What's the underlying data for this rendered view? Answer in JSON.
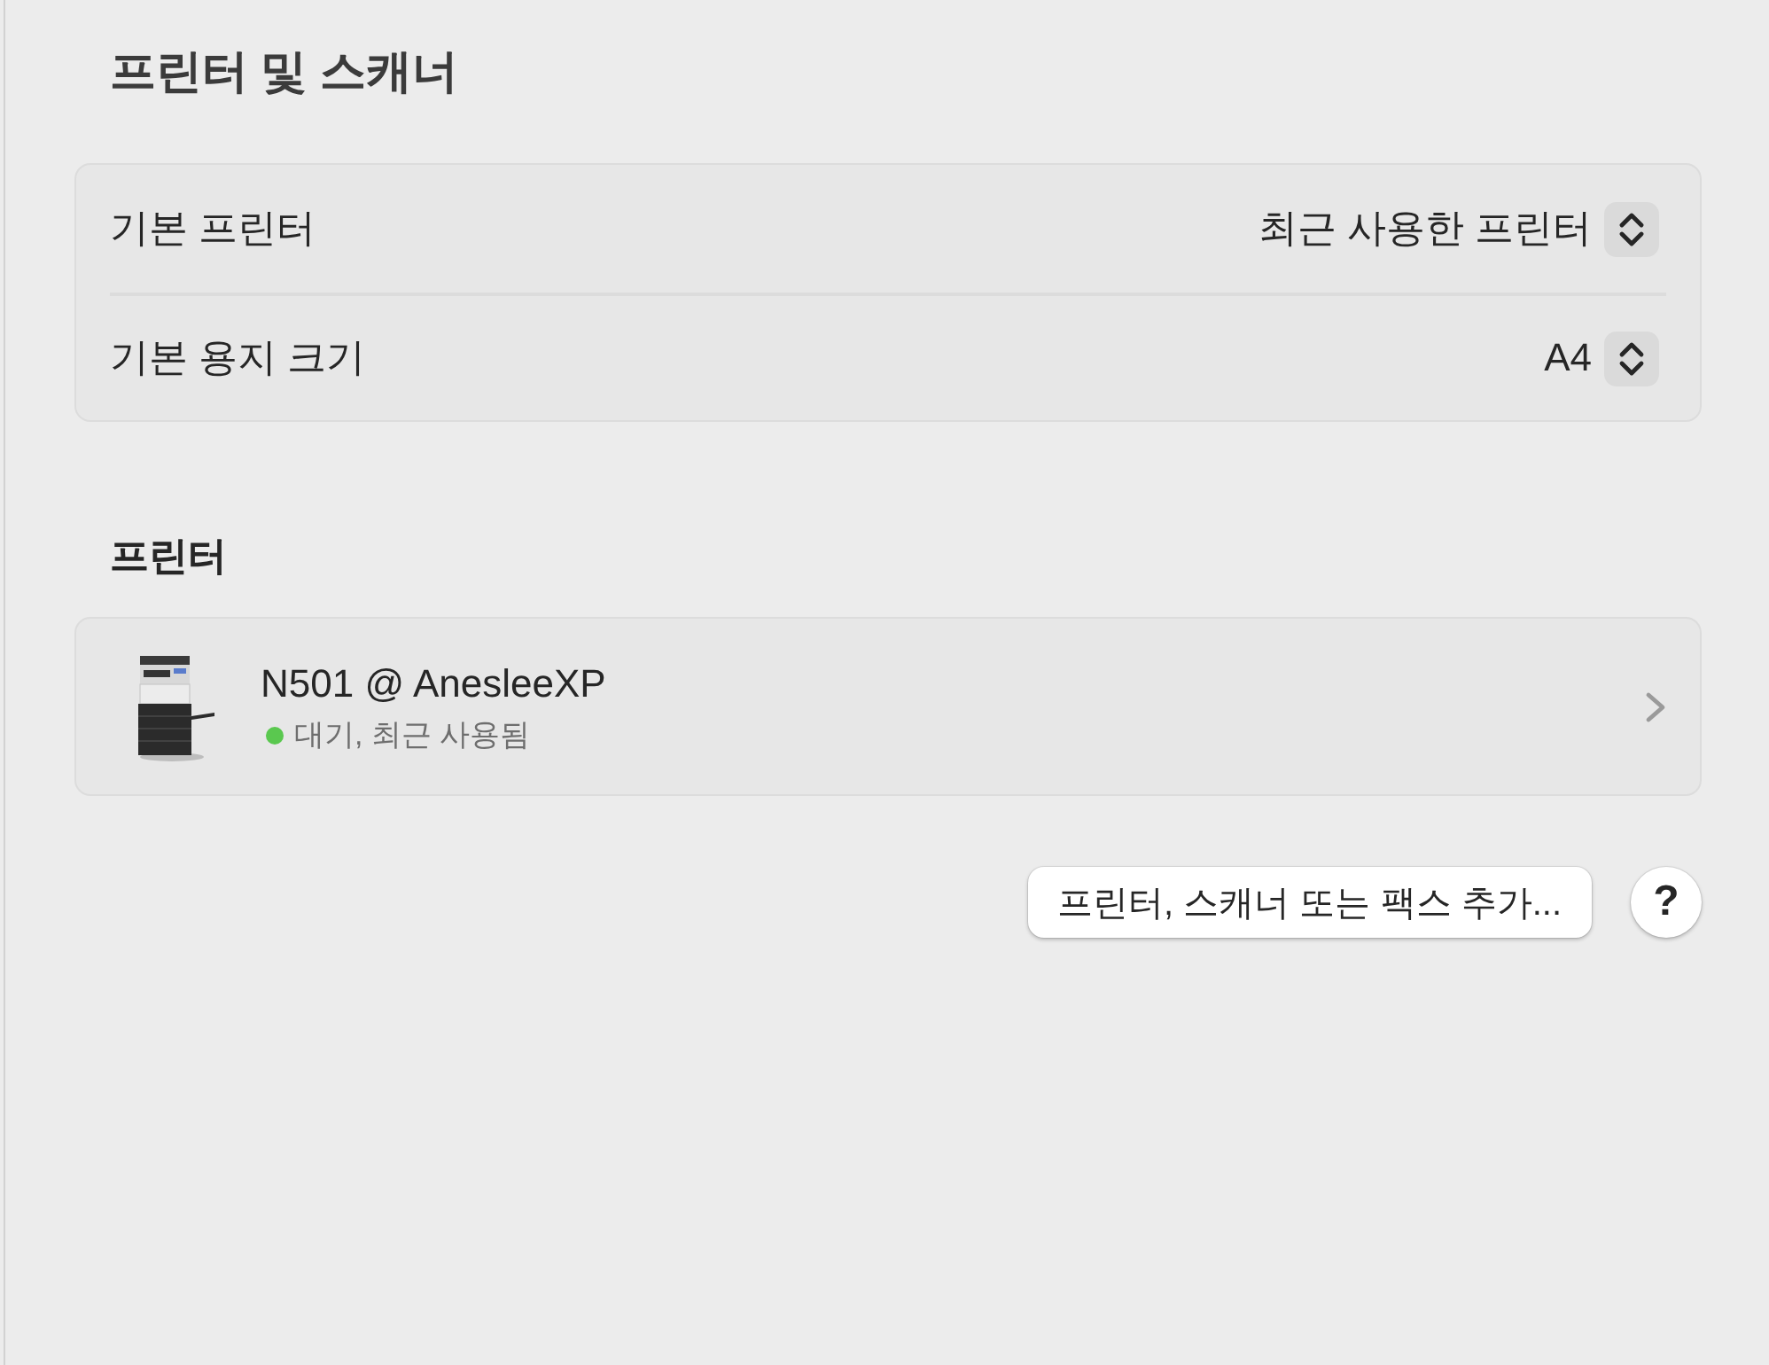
{
  "window": {
    "title": "프린터 및 스캐너"
  },
  "settings": [
    {
      "label": "기본 프린터",
      "value": "최근 사용한 프린터"
    },
    {
      "label": "기본 용지 크기",
      "value": "A4"
    }
  ],
  "printers_section": {
    "heading": "프린터",
    "printers": [
      {
        "name": "N501 @ AnesleeXP",
        "status": "대기, 최근 사용됨",
        "color": "#5ac84f"
      }
    ]
  },
  "buttons": {
    "add": "프린터, 스캐너 또는 팩스 추가...",
    "help": "?"
  }
}
